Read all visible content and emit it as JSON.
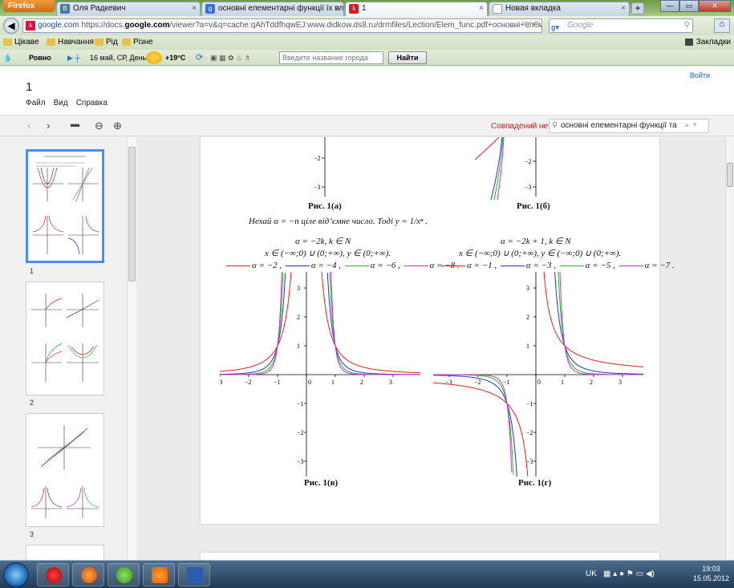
{
  "browser": {
    "menu_button": "Firefox",
    "tabs": [
      {
        "title": "Оля Радкевич",
        "icon": "vk-icon"
      },
      {
        "title": "основні елементарні функції їх влас…",
        "icon": "google-icon"
      },
      {
        "title": "1",
        "icon": "pdf-icon"
      },
      {
        "title": "Новая вкладка",
        "icon": "blank-page-icon"
      }
    ],
    "new_tab": "+",
    "url_site": "google.com",
    "url_prefix": "https://docs.",
    "url_domain": "google.com",
    "url_rest": "/viewer?a=v&q=cache:qAhTddfhqwEJ:www.didkow.ds8.ru/drmfiles/Lection/Elem_func.pdf+основні+елементарні+",
    "search_placeholder": "Google",
    "bookmarks": [
      "Цікаве",
      "Навчання",
      "Рід",
      "Різне"
    ],
    "bookmarks_right": "Закладки",
    "weather": {
      "city": "Ровно",
      "date": "16 май, СР, День",
      "temp": "+19°C",
      "city_placeholder": "Введите название города",
      "find_button": "Найти"
    }
  },
  "viewer": {
    "title": "1",
    "menu": [
      "Файл",
      "Вид",
      "Справка"
    ],
    "signin": "Войти",
    "no_matches": "Совпадений нет",
    "find_query": "основні елементарні функції та",
    "pages": [
      "1",
      "2",
      "3"
    ]
  },
  "document": {
    "caption_a": "Рис. 1(а)",
    "caption_b": "Рис. 1(б)",
    "intro": "Нехай α = −n ціле від’ємне число. Тоді y = 1/xⁿ .",
    "left_header1": "α = −2k, k ∈ N",
    "left_header2": "x ∈ (−∞;0) ∪ (0;+∞), y ∈ (0;+∞).",
    "left_legend": [
      "α = −2 ,",
      "α = −4 ,",
      "α = −6 ,",
      "α = −8 ."
    ],
    "right_header1": "α = −2k + 1, k ∈ N",
    "right_header2": "x ∈ (−∞;0) ∪ (0;+∞), y ∈ (−∞;0) ∪ (0;+∞).",
    "right_legend": [
      "α = −1 ,",
      "α = −3 ,",
      "α = −5 ,",
      "α = −7 ."
    ],
    "caption_c": "Рис. 1(в)",
    "caption_d": "Рис. 1(г)",
    "x_ticks": [
      "−3",
      "−2",
      "−1",
      "0",
      "1",
      "2",
      "3"
    ],
    "y_ticks_pos": [
      "3",
      "2",
      "1"
    ],
    "y_ticks_neg": [
      "−1",
      "−2",
      "−3"
    ],
    "colors": {
      "red": "#e02020",
      "blue": "#2233cc",
      "green": "#22bb22",
      "magenta": "#cc33cc"
    }
  },
  "taskbar": {
    "lang": "UK",
    "time": "19:03",
    "date": "15.05.2012"
  }
}
